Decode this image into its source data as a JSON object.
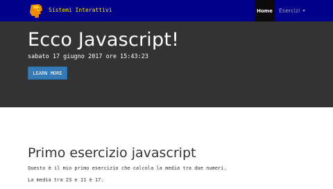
{
  "navbar": {
    "brand_text": "Sistemi Interattivi",
    "brand_logo_icon": "logo-icon",
    "items": [
      {
        "label": "Home",
        "active": true
      },
      {
        "label": "Esercizi",
        "dropdown": true
      }
    ]
  },
  "hero": {
    "title": "Ecco Javascript!",
    "datetime": "sabato 17 giugno 2017 ore 15:43:23",
    "button_label": "LEARN MORE"
  },
  "content": {
    "heading": "Primo esercizio javascript",
    "paragraphs": [
      "Questo è il mio primo esercizio che calcola la media tra due numeri.",
      "La media tra 23 e 11 è 17."
    ]
  },
  "colors": {
    "navbar_bg": "#00008b",
    "brand_text": "#ffeb00",
    "hero_bg": "#333333",
    "button_bg": "#337ab7"
  }
}
